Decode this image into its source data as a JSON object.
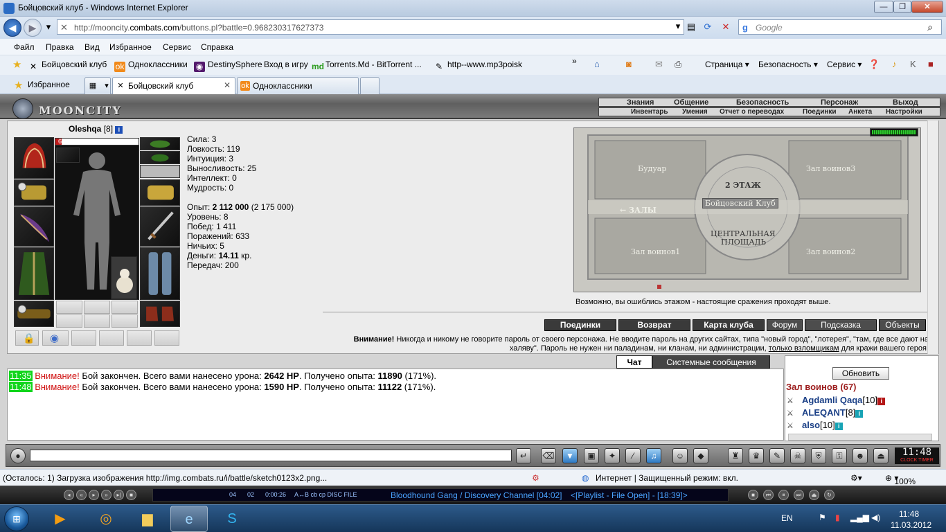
{
  "window": {
    "title": "Бойцовский клуб - Windows Internet Explorer",
    "minimize": "—",
    "maximize": "❐",
    "close": "✕"
  },
  "address": {
    "url_prefix": "http://mooncity.",
    "url_domain": "combats.com",
    "url_path": "/buttons.pl?battle=0.968230317627373",
    "search_placeholder": "Google"
  },
  "menu": [
    "Файл",
    "Правка",
    "Вид",
    "Избранное",
    "Сервис",
    "Справка"
  ],
  "favorites_bar": {
    "items": [
      "Бойцовский клуб",
      "Одноклассники",
      "DestinySphere",
      "Вход в игру",
      "Torrents.Md - BitTorrent ...",
      "http--www.mp3poisk"
    ],
    "more": "»",
    "page_menu": "Страница",
    "safety_menu": "Безопасность",
    "tools_menu": "Сервис"
  },
  "tabs": {
    "favorites_label": "Избранное",
    "items": [
      {
        "label": "Бойцовский клуб",
        "active": true
      },
      {
        "label": "Одноклассники",
        "active": false
      }
    ]
  },
  "game": {
    "logo": "MOONCITY",
    "top_menu": [
      "Знания",
      "Общение",
      "Безопасность",
      "Персонаж",
      "Выход"
    ],
    "sub_menu": [
      "Инвентарь",
      "Умения",
      "Отчет о переводах",
      "Поединки",
      "Анкета",
      "Настройки"
    ],
    "character": {
      "name": "Oleshqa",
      "level": "[8]",
      "hp_text": "69/966",
      "hp_fraction": 0.0714
    },
    "stats": [
      {
        "label": "Сила: ",
        "value": "3"
      },
      {
        "label": "Ловкость: ",
        "value": "119"
      },
      {
        "label": "Интуиция: ",
        "value": "3"
      },
      {
        "label": "Выносливость: ",
        "value": "25"
      },
      {
        "label": "Интеллект: ",
        "value": "0"
      },
      {
        "label": "Мудрость: ",
        "value": "0"
      }
    ],
    "exp": {
      "label": "Опыт: ",
      "value": "2 112 000",
      "next": " (2 175 000)"
    },
    "level_line": {
      "label": "Уровень: ",
      "value": "8"
    },
    "wins": {
      "label": "Побед: ",
      "value": "1 411"
    },
    "losses": {
      "label": "Поражений: ",
      "value": "633"
    },
    "draws": {
      "label": "Ничьих: ",
      "value": "5"
    },
    "money": {
      "label": "Деньги: ",
      "value": "14.11",
      "unit": " кр."
    },
    "transfers": {
      "label": "Передач: ",
      "value": "200"
    },
    "map": {
      "rooms": [
        "Будуар",
        "Зал воинов3",
        "Бойцовский Клуб",
        "Зал воинов1",
        "Зал воинов2"
      ],
      "floor": "2 ЭТАЖ",
      "halls": "← ЗАЛЫ",
      "center_line1": "ЦЕНТРАЛЬНАЯ",
      "center_line2": "ПЛОЩАДЬ",
      "note": "Возможно, вы ошиблись этажом - настоящие сражения проходят выше."
    },
    "buttons": [
      "Поединки",
      "Возврат",
      "Карта клуба",
      "Форум",
      "Подсказка",
      "Объекты"
    ],
    "warning": {
      "title": "Внимание!",
      "text1": " Никогда и никому не говорите пароль от своего персонажа. Не вводите пароль на других сайтах, типа \"новый город\", \"лотерея\", \"там, где все дают на халяву\". Пароль не нужен ни паладинам, ни кланам, ни администрации, ",
      "link": "только взломщикам",
      "text2": " для кражи вашего героя."
    }
  },
  "chat": {
    "tab_chat": "Чат",
    "tab_system": "Системные сообщения",
    "messages": [
      {
        "time": "11:35",
        "warn": "Внимание!",
        "p1": " Бой закончен. Всего вами нанесено урона: ",
        "dmg": "2642 HP",
        "p2": ". Получено опыта: ",
        "exp": "11890",
        "p3": " (171%)."
      },
      {
        "time": "11:48",
        "warn": "Внимание!",
        "p1": " Бой закончен. Всего вами нанесено урона: ",
        "dmg": "1590 HP",
        "p2": ". Получено опыта: ",
        "exp": "11122",
        "p3": " (171%)."
      }
    ]
  },
  "online": {
    "refresh": "Обновить",
    "room": "Зал воинов (67)",
    "users": [
      {
        "name": "Agdamli Qaqa",
        "level": "[10]"
      },
      {
        "name": "ALEQANT",
        "level": "[8]"
      },
      {
        "name": "also",
        "level": "[10]"
      }
    ]
  },
  "clock": {
    "time": "11:48",
    "label": "CLOCK TIMER"
  },
  "status": {
    "loading": "(Осталось: 1) Загрузка изображения http://img.combats.ru/i/battle/sketch0123x2.png...",
    "zone": "Интернет | Защищенный режим: вкл.",
    "zoom": "100%"
  },
  "player": {
    "track_num": "04",
    "track_num2": "02",
    "elapsed": "0:00:26",
    "flags": "A↔B  cb  cp  DISC  FILE",
    "track": "Bloodhound Gang / Discovery Channel  [04:02]",
    "playlist": "<[Playlist - File Open] - [18:39]>"
  },
  "taskbar": {
    "lang": "EN",
    "time": "11:48",
    "date": "11.03.2012"
  }
}
